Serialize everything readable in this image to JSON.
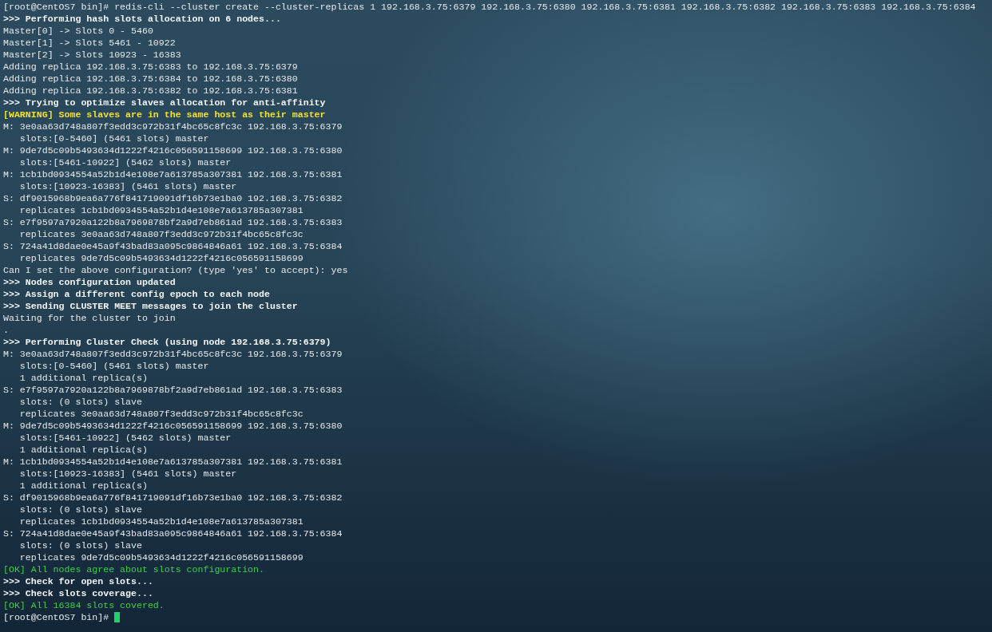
{
  "terminal": {
    "lines": [
      {
        "kind": "command",
        "text": "[root@CentOS7 bin]# redis-cli --cluster create --cluster-replicas 1 192.168.3.75:6379 192.168.3.75:6380 192.168.3.75:6381 192.168.3.75:6382 192.168.3.75:6383 192.168.3.75:6384"
      },
      {
        "kind": "heading",
        "text": ">>> Performing hash slots allocation on 6 nodes..."
      },
      {
        "kind": "normal",
        "text": "Master[0] -> Slots 0 - 5460"
      },
      {
        "kind": "normal",
        "text": "Master[1] -> Slots 5461 - 10922"
      },
      {
        "kind": "normal",
        "text": "Master[2] -> Slots 10923 - 16383"
      },
      {
        "kind": "normal",
        "text": "Adding replica 192.168.3.75:6383 to 192.168.3.75:6379"
      },
      {
        "kind": "normal",
        "text": "Adding replica 192.168.3.75:6384 to 192.168.3.75:6380"
      },
      {
        "kind": "normal",
        "text": "Adding replica 192.168.3.75:6382 to 192.168.3.75:6381"
      },
      {
        "kind": "heading",
        "text": ">>> Trying to optimize slaves allocation for anti-affinity"
      },
      {
        "kind": "warning",
        "text": "[WARNING] Some slaves are in the same host as their master"
      },
      {
        "kind": "normal",
        "text": "M: 3e0aa63d748a807f3edd3c972b31f4bc65c8fc3c 192.168.3.75:6379"
      },
      {
        "kind": "normal",
        "text": "   slots:[0-5460] (5461 slots) master"
      },
      {
        "kind": "normal",
        "text": "M: 9de7d5c09b5493634d1222f4216c056591158699 192.168.3.75:6380"
      },
      {
        "kind": "normal",
        "text": "   slots:[5461-10922] (5462 slots) master"
      },
      {
        "kind": "normal",
        "text": "M: 1cb1bd0934554a52b1d4e108e7a613785a307381 192.168.3.75:6381"
      },
      {
        "kind": "normal",
        "text": "   slots:[10923-16383] (5461 slots) master"
      },
      {
        "kind": "normal",
        "text": "S: df9015968b9ea6a776f841719091df16b73e1ba0 192.168.3.75:6382"
      },
      {
        "kind": "normal",
        "text": "   replicates 1cb1bd0934554a52b1d4e108e7a613785a307381"
      },
      {
        "kind": "normal",
        "text": "S: e7f9597a7920a122b8a7969878bf2a9d7eb861ad 192.168.3.75:6383"
      },
      {
        "kind": "normal",
        "text": "   replicates 3e0aa63d748a807f3edd3c972b31f4bc65c8fc3c"
      },
      {
        "kind": "normal",
        "text": "S: 724a41d8dae0e45a9f43bad83a095c9864846a61 192.168.3.75:6384"
      },
      {
        "kind": "normal",
        "text": "   replicates 9de7d5c09b5493634d1222f4216c056591158699"
      },
      {
        "kind": "normal",
        "text": "Can I set the above configuration? (type 'yes' to accept): yes"
      },
      {
        "kind": "heading",
        "text": ">>> Nodes configuration updated"
      },
      {
        "kind": "heading",
        "text": ">>> Assign a different config epoch to each node"
      },
      {
        "kind": "heading",
        "text": ">>> Sending CLUSTER MEET messages to join the cluster"
      },
      {
        "kind": "normal",
        "text": "Waiting for the cluster to join"
      },
      {
        "kind": "normal",
        "text": "."
      },
      {
        "kind": "heading",
        "text": ">>> Performing Cluster Check (using node 192.168.3.75:6379)"
      },
      {
        "kind": "normal",
        "text": "M: 3e0aa63d748a807f3edd3c972b31f4bc65c8fc3c 192.168.3.75:6379"
      },
      {
        "kind": "normal",
        "text": "   slots:[0-5460] (5461 slots) master"
      },
      {
        "kind": "normal",
        "text": "   1 additional replica(s)"
      },
      {
        "kind": "normal",
        "text": "S: e7f9597a7920a122b8a7969878bf2a9d7eb861ad 192.168.3.75:6383"
      },
      {
        "kind": "normal",
        "text": "   slots: (0 slots) slave"
      },
      {
        "kind": "normal",
        "text": "   replicates 3e0aa63d748a807f3edd3c972b31f4bc65c8fc3c"
      },
      {
        "kind": "normal",
        "text": "M: 9de7d5c09b5493634d1222f4216c056591158699 192.168.3.75:6380"
      },
      {
        "kind": "normal",
        "text": "   slots:[5461-10922] (5462 slots) master"
      },
      {
        "kind": "normal",
        "text": "   1 additional replica(s)"
      },
      {
        "kind": "normal",
        "text": "M: 1cb1bd0934554a52b1d4e108e7a613785a307381 192.168.3.75:6381"
      },
      {
        "kind": "normal",
        "text": "   slots:[10923-16383] (5461 slots) master"
      },
      {
        "kind": "normal",
        "text": "   1 additional replica(s)"
      },
      {
        "kind": "normal",
        "text": "S: df9015968b9ea6a776f841719091df16b73e1ba0 192.168.3.75:6382"
      },
      {
        "kind": "normal",
        "text": "   slots: (0 slots) slave"
      },
      {
        "kind": "normal",
        "text": "   replicates 1cb1bd0934554a52b1d4e108e7a613785a307381"
      },
      {
        "kind": "normal",
        "text": "S: 724a41d8dae0e45a9f43bad83a095c9864846a61 192.168.3.75:6384"
      },
      {
        "kind": "normal",
        "text": "   slots: (0 slots) slave"
      },
      {
        "kind": "normal",
        "text": "   replicates 9de7d5c09b5493634d1222f4216c056591158699"
      },
      {
        "kind": "ok",
        "text": "[OK] All nodes agree about slots configuration."
      },
      {
        "kind": "heading",
        "text": ">>> Check for open slots..."
      },
      {
        "kind": "heading",
        "text": ">>> Check slots coverage..."
      },
      {
        "kind": "ok",
        "text": "[OK] All 16384 slots covered."
      },
      {
        "kind": "prompt",
        "text": "[root@CentOS7 bin]#"
      }
    ]
  }
}
